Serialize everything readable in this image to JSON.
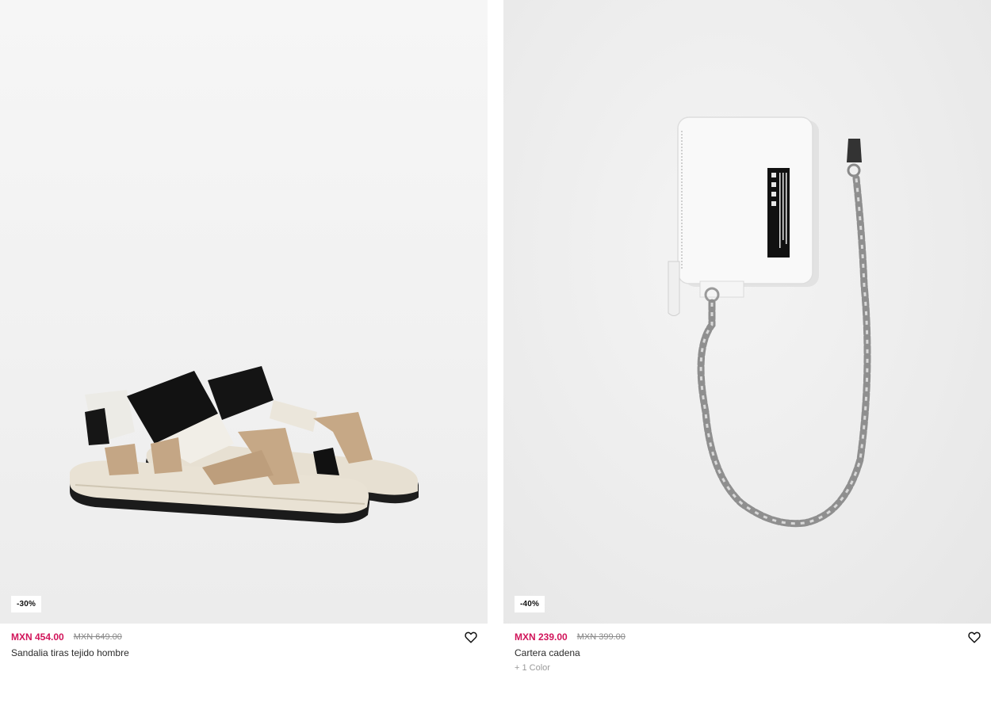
{
  "products": [
    {
      "discount_badge": "-30%",
      "price_current": "MXN 454.00",
      "price_original": "MXN 649.00",
      "name": "Sandalia tiras tejido hombre",
      "colors_note": "",
      "image_icon": "sandal-image",
      "wishlist_icon": "heart-icon"
    },
    {
      "discount_badge": "-40%",
      "price_current": "MXN 239.00",
      "price_original": "MXN 399.00",
      "name": "Cartera cadena",
      "colors_note": "+ 1 Color",
      "image_icon": "wallet-chain-image",
      "wishlist_icon": "heart-icon"
    }
  ],
  "colors": {
    "sale_price": "#d1145a",
    "original_price": "#8a8a8a",
    "text": "#2b2b2b"
  }
}
